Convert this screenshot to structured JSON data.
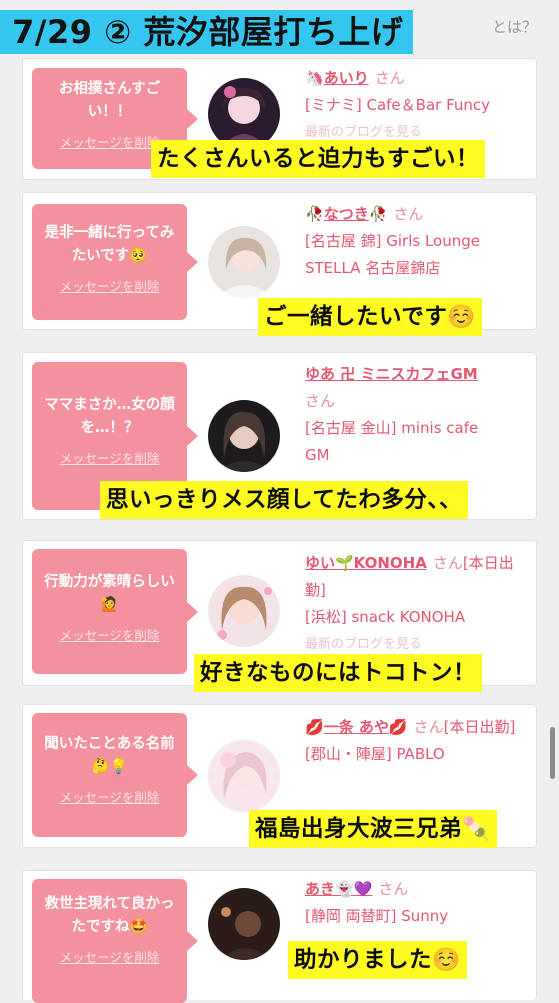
{
  "header": {
    "title": "7/29 ② 荒汐部屋打ち上げ",
    "faded_link": "とは？"
  },
  "delete_label": "メッセージを削除",
  "honorific": "さん",
  "cards": [
    {
      "message": "お相撲さんすごい！！",
      "name_prefix": "🦄",
      "name": "あいり",
      "name_suffix": "",
      "status": "",
      "shop": "[ミナミ] Cafe＆Bar Funcy",
      "shop2": "",
      "faded": "最新のブログを見る",
      "caption": "たくさんいると迫力もすごい！",
      "caption_emoji": ""
    },
    {
      "message": "是非一緒に行ってみたいです🥺",
      "name_prefix": "🥀",
      "name": "なつき",
      "name_suffix": "🥀",
      "status": "",
      "shop": "[名古屋 錦] Girls Lounge",
      "shop2": "STELLA 名古屋錦店",
      "faded": "",
      "caption": "ご一緒したいです",
      "caption_emoji": "☺️"
    },
    {
      "message": "ママまさか…女の顔を…！？",
      "name_prefix": "",
      "name": "ゆあ 卍 ミニスカフェGM",
      "name_suffix": "",
      "status": "",
      "shop": "[名古屋 金山] minis cafe",
      "shop2": "GM",
      "faded": "",
      "caption": "思いっきりメス顔してたわ多分、、",
      "caption_emoji": ""
    },
    {
      "message": "行動力が素晴らしい🙋",
      "name_prefix": "",
      "name": "ゆい🌱KONOHA",
      "name_suffix": "",
      "status": "[本日出勤]",
      "shop": "[浜松] snack KONOHA",
      "shop2": "",
      "faded": "最新のブログを見る",
      "caption": "好きなものにはトコトン！",
      "caption_emoji": ""
    },
    {
      "message": "聞いたことある名前🤔💡",
      "name_prefix": "💋",
      "name": "一条 あや",
      "name_suffix": "💋",
      "status": "[本日出勤]",
      "shop": "[郡山・陣屋] PABLO",
      "shop2": "",
      "faded": "",
      "caption": "福島出身大波三兄弟",
      "caption_emoji": "🍡"
    },
    {
      "message": "救世主現れて良かったですね🤩",
      "name_prefix": "",
      "name": "あき👻💜",
      "name_suffix": "",
      "status": "",
      "shop": "[静岡 両替町] Sunny",
      "shop2": "",
      "faded": "",
      "caption": "助かりました",
      "caption_emoji": "☺️"
    }
  ],
  "colors": {
    "banner": "#34c6ef",
    "bubble": "#f3919e",
    "link": "#e2586f",
    "caption_bg": "#fffb22",
    "page_bg": "#efeff2"
  }
}
